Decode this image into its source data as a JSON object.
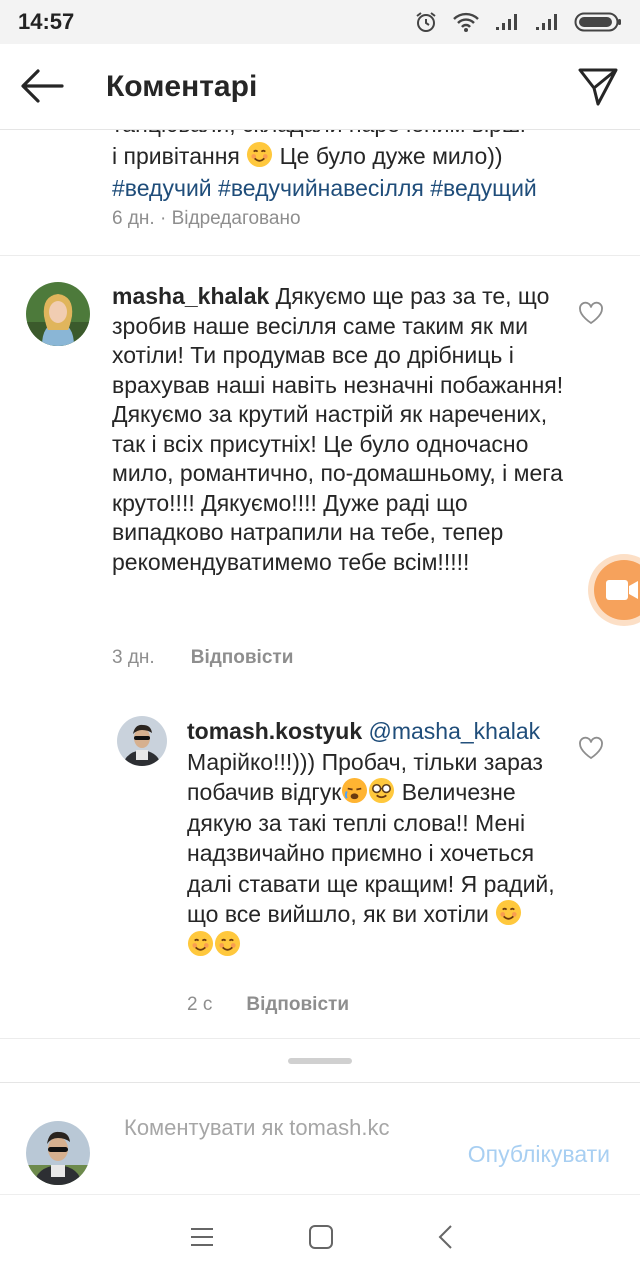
{
  "status_bar": {
    "time": "14:57"
  },
  "header": {
    "title": "Коментарі"
  },
  "previous_comment": {
    "clipped_line": "танцювали, складали нареченим вірші",
    "line2": "і привітання",
    "line2_tail": " Це було дуже мило))",
    "hashtags": "#ведучий #ведучийнавесілля #ведущий",
    "meta": "6 дн. · Відредаговано"
  },
  "comments": [
    {
      "username": "masha_khalak",
      "text": " Дякуємо ще раз за те, що зробив наше весілля саме таким як ми хотіли! Ти продумав все до дрібниць і врахував наші навіть незначні побажання! Дякуємо за крутий настрій як наречених,  так і всіх присутніх! Це було одночасно мило, романтично, по-домашньому, і мега круто!!!! Дякуємо!!!! Дуже раді що випадково натрапили на тебе, тепер рекомендуватимемо тебе всім!!!!!",
      "time": "3 дн.",
      "reply_label": "Відповісти"
    }
  ],
  "reply": {
    "username": "tomash.kostyuk",
    "mention": " @masha_khalak",
    "text_part1": " Марійко!!!))) Пробач, тільки зараз побачив відгук",
    "text_part2": " Величезне дякую за такі теплі слова!! Мені надзвичайно приємно і хочеться далі ставати ще кращим! Я радий, що все вийшло, як ви хотіли ",
    "time": "2 с",
    "reply_label": "Відповісти"
  },
  "compose": {
    "placeholder": "Коментувати як tomash.kc",
    "publish_label": "Опублікувати"
  },
  "colors": {
    "hashtag": "#1f4d7a",
    "meta_gray": "#8e8e8e",
    "publish_disabled": "#a8cff2",
    "float_button": "#f6a25c"
  },
  "icons": [
    "back-arrow-icon",
    "send-icon",
    "heart-outline-icon",
    "video-camera-icon",
    "alarm-icon",
    "wifi-icon",
    "signal-icon",
    "battery-icon",
    "menu-icon",
    "home-square-icon",
    "back-chevron-icon"
  ]
}
